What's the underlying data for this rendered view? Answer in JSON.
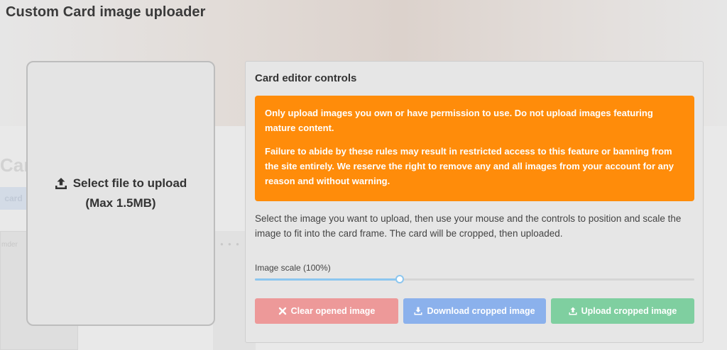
{
  "modal": {
    "title": "Custom Card image uploader"
  },
  "background": {
    "faded_title": "Car",
    "faded_chip": "card",
    "faded_label": "mder"
  },
  "upload_zone": {
    "line1": "Select file to upload",
    "line2": "(Max 1.5MB)",
    "icon": "upload-icon"
  },
  "controls": {
    "heading": "Card editor controls",
    "warning": {
      "paragraph1": "Only upload images you own or have permission to use. Do not upload images featuring mature content.",
      "paragraph2": "Failure to abide by these rules may result in restricted access to this feature or banning from the site entirely. We reserve the right to remove any and all images from your account for any reason and without warning.",
      "color": "#ff8c0a"
    },
    "instructions": "Select the image you want to upload, then use your mouse and the controls to position and scale the image to fit into the card frame. The card will be cropped, then uploaded.",
    "scale": {
      "label": "Image scale (100%)",
      "value_fraction": 0.33
    },
    "buttons": {
      "clear": {
        "label": "Clear opened image",
        "icon": "close-icon",
        "color": "#ed9999"
      },
      "download": {
        "label": "Download cropped image",
        "icon": "download-icon",
        "color": "#8bb1ec"
      },
      "upload": {
        "label": "Upload cropped image",
        "icon": "upload-icon",
        "color": "#7fcfa0"
      }
    }
  }
}
